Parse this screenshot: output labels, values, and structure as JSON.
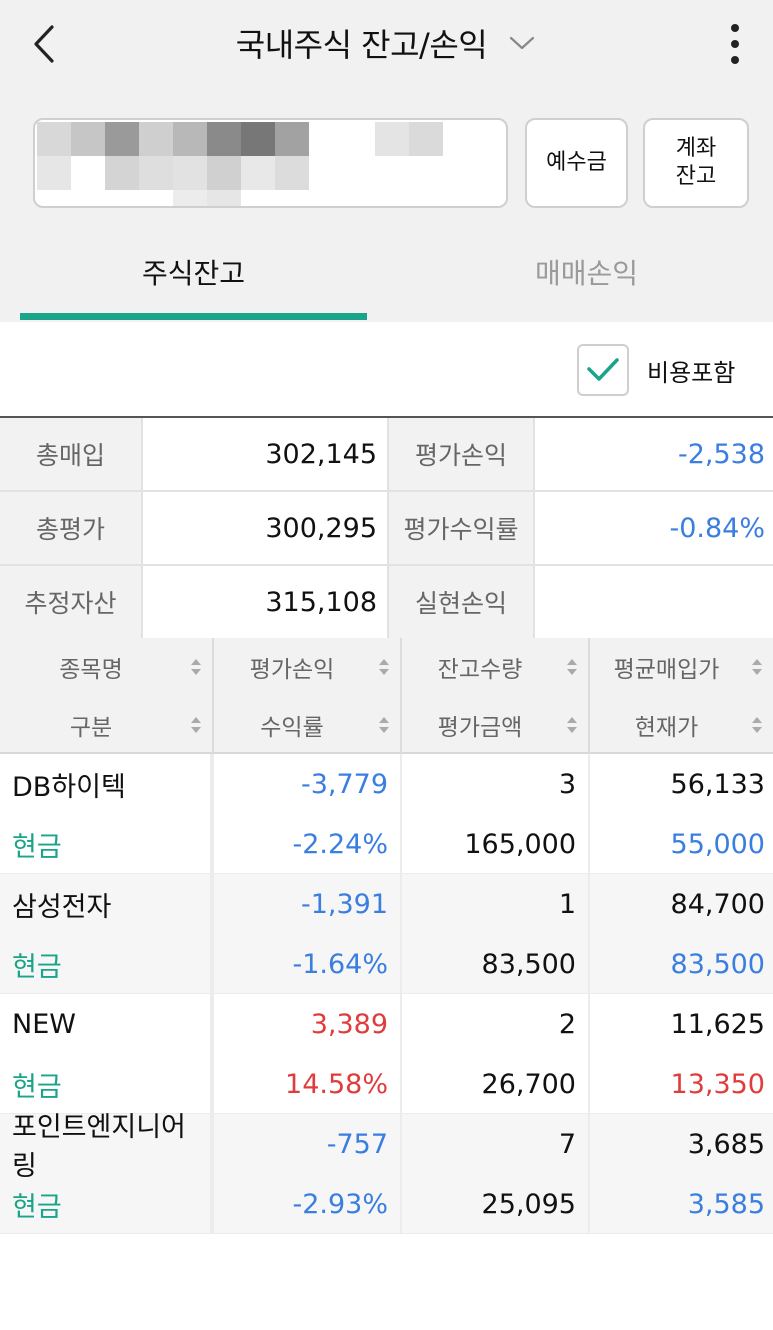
{
  "header": {
    "title": "국내주식 잔고/손익"
  },
  "buttons": {
    "deposit": "예수금",
    "account_balance": "계좌\n잔고"
  },
  "tabs": [
    {
      "label": "주식잔고",
      "active": true
    },
    {
      "label": "매매손익",
      "active": false
    }
  ],
  "options": {
    "include_fees_label": "비용포함",
    "include_fees_checked": true
  },
  "summary": {
    "rows": [
      {
        "label1": "총매입",
        "value1": "302,145",
        "label2": "평가손익",
        "value2": "-2,538"
      },
      {
        "label1": "총평가",
        "value1": "300,295",
        "label2": "평가수익률",
        "value2": "-0.84%"
      },
      {
        "label1": "추정자산",
        "value1": "315,108",
        "label2": "실현손익",
        "value2": ""
      }
    ]
  },
  "table": {
    "headers_top": [
      "종목명",
      "평가손익",
      "잔고수량",
      "평균매입가"
    ],
    "headers_bottom": [
      "구분",
      "수익률",
      "평가금액",
      "현재가"
    ],
    "rows": [
      {
        "name": "DB하이텍",
        "type": "현금",
        "pnl": "-3,779",
        "rate": "-2.24%",
        "qty": "3",
        "eval": "165,000",
        "avg_price": "56,133",
        "cur_price": "55,000"
      },
      {
        "name": "삼성전자",
        "type": "현금",
        "pnl": "-1,391",
        "rate": "-1.64%",
        "qty": "1",
        "eval": "83,500",
        "avg_price": "84,700",
        "cur_price": "83,500"
      },
      {
        "name": "NEW",
        "type": "현금",
        "pnl": "3,389",
        "rate": "14.58%",
        "qty": "2",
        "eval": "26,700",
        "avg_price": "11,625",
        "cur_price": "13,350"
      },
      {
        "name": "포인트엔지니어링",
        "type": "현금",
        "pnl": "-757",
        "rate": "-2.93%",
        "qty": "7",
        "eval": "25,095",
        "avg_price": "3,685",
        "cur_price": "3,585"
      }
    ]
  },
  "colors": {
    "accent": "#1aa58a",
    "loss": "#3a7ee0",
    "gain": "#e03c3c"
  }
}
